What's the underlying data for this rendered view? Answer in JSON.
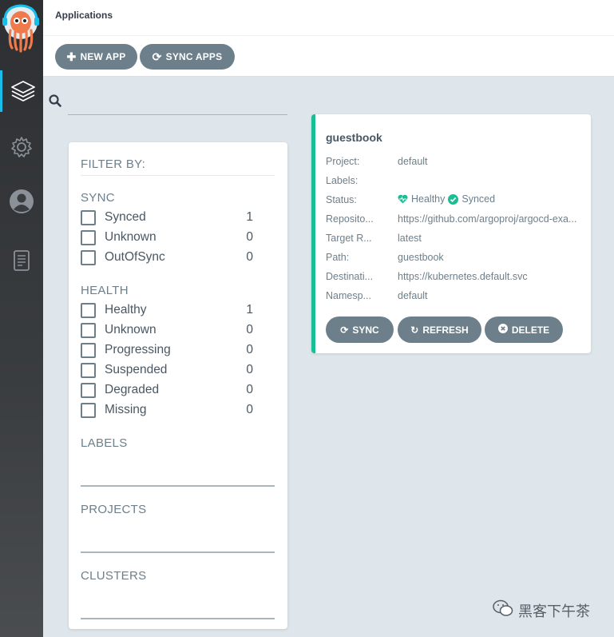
{
  "header": {
    "title": "Applications",
    "buttons": {
      "new_app": "NEW APP",
      "sync_apps": "SYNC APPS"
    }
  },
  "sidebar": {
    "items": [
      {
        "icon": "layers-icon",
        "active": true
      },
      {
        "icon": "gear-icon"
      },
      {
        "icon": "user-icon"
      },
      {
        "icon": "docs-icon"
      }
    ]
  },
  "search": {
    "value": "",
    "icon": "search-icon"
  },
  "filter": {
    "title": "FILTER BY:",
    "sync": {
      "title": "SYNC",
      "items": [
        {
          "label": "Synced",
          "count": "1"
        },
        {
          "label": "Unknown",
          "count": "0"
        },
        {
          "label": "OutOfSync",
          "count": "0"
        }
      ]
    },
    "health": {
      "title": "HEALTH",
      "items": [
        {
          "label": "Healthy",
          "count": "1"
        },
        {
          "label": "Unknown",
          "count": "0"
        },
        {
          "label": "Progressing",
          "count": "0"
        },
        {
          "label": "Suspended",
          "count": "0"
        },
        {
          "label": "Degraded",
          "count": "0"
        },
        {
          "label": "Missing",
          "count": "0"
        }
      ]
    },
    "labels": {
      "title": "LABELS"
    },
    "projects": {
      "title": "PROJECTS"
    },
    "clusters": {
      "title": "CLUSTERS"
    }
  },
  "app_card": {
    "name": "guestbook",
    "fields": {
      "project": {
        "label": "Project:",
        "value": "default"
      },
      "labels": {
        "label": "Labels:",
        "value": ""
      },
      "status": {
        "label": "Status:",
        "health": "Healthy",
        "sync": "Synced"
      },
      "repository": {
        "label": "Reposito...",
        "value": "https://github.com/argoproj/argocd-exa..."
      },
      "target_revision": {
        "label": "Target R...",
        "value": "latest"
      },
      "path": {
        "label": "Path:",
        "value": "guestbook"
      },
      "destination": {
        "label": "Destinati...",
        "value": "https://kubernetes.default.svc"
      },
      "namespace": {
        "label": "Namesp...",
        "value": "default"
      }
    },
    "buttons": {
      "sync": "SYNC",
      "refresh": "REFRESH",
      "delete": "DELETE"
    }
  },
  "watermark": {
    "text": "黑客下午茶"
  },
  "colors": {
    "accent": "#18bee9",
    "healthy": "#18be94",
    "button": "#6d7f8b",
    "background": "#dee6eb",
    "sidebar": "#2d2f32"
  }
}
